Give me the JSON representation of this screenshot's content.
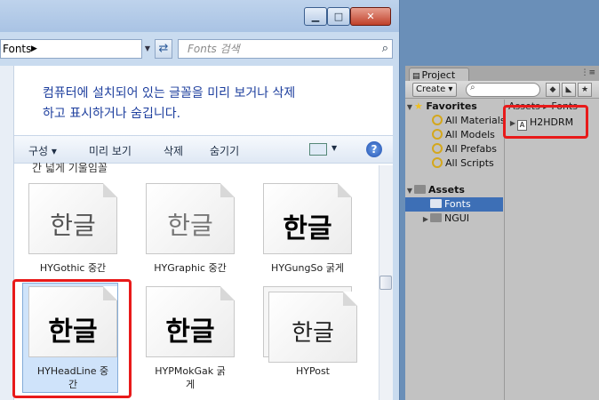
{
  "explorer": {
    "address": "Fonts",
    "search_placeholder": "Fonts 검색",
    "info_line1": "컴퓨터에 설치되어 있는 글꼴을 미리 보거나 삭제",
    "info_line2": "하고 표시하거나 숨깁니다.",
    "toolbar": {
      "organize": "구성 ▾",
      "preview": "미리 보기",
      "delete": "삭제",
      "hide": "숨기기"
    },
    "partial_header": "간 넓게 기울임꼴",
    "fonts": [
      {
        "sample": "한글",
        "label": "HYGothic 중간"
      },
      {
        "sample": "한글",
        "label": "HYGraphic 중간"
      },
      {
        "sample": "한글",
        "label": "HYGungSo 굵게"
      },
      {
        "sample": "한글",
        "label_l1": "HYHeadLine 중",
        "label_l2": "간"
      },
      {
        "sample": "한글",
        "label_l1": "HYPMokGak 굵",
        "label_l2": "게"
      },
      {
        "sample": "한글",
        "label": "HYPost"
      }
    ]
  },
  "unity": {
    "tab_label": "Project",
    "create_label": "Create ▾",
    "tree": {
      "favorites": "Favorites",
      "fav_items": [
        "All Materials",
        "All Models",
        "All Prefabs",
        "All Scripts"
      ],
      "assets": "Assets",
      "fonts": "Fonts",
      "ngui": "NGUI"
    },
    "breadcrumb": "Assets ▸ Fonts",
    "file": "H2HDRM"
  }
}
